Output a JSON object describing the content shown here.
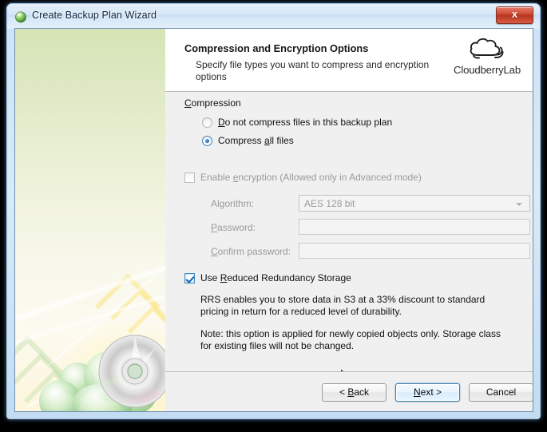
{
  "window": {
    "title": "Create Backup Plan Wizard",
    "title_icon": "green-sphere-icon",
    "close_label": "x"
  },
  "header": {
    "title": "Compression and Encryption Options",
    "subtitle": "Specify file types you want to compress and encryption options",
    "logo_text": "CloudberryLab",
    "logo_icon": "cloud-icon"
  },
  "compression": {
    "group_label": "Compression",
    "group_label_pre": "C",
    "group_label_post": "ompression",
    "options": [
      {
        "pre": "D",
        "rest_a": "o not compress files in this backup plan",
        "full": "Do not compress files in this backup plan",
        "selected": false
      },
      {
        "pre": "Compress ",
        "accel": "a",
        "post": "ll files",
        "full": "Compress all files",
        "selected": true
      }
    ]
  },
  "encryption": {
    "enable_pre": "Enable ",
    "enable_accel": "e",
    "enable_post": "ncryption (Allowed only in Advanced mode)",
    "enable_full": "Enable encryption (Allowed only in Advanced mode)",
    "enabled": false,
    "algorithm_label": "Algorithm:",
    "algorithm_label_pre": "Al",
    "algorithm_label_accel": "g",
    "algorithm_label_post": "orithm:",
    "algorithm_value": "AES 128 bit",
    "algorithm_options": [
      "AES 128 bit"
    ],
    "password_label": "Password:",
    "password_label_accel": "P",
    "password_label_post": "assword:",
    "password_value": "",
    "confirm_label": "Confirm password:",
    "confirm_label_accel": "C",
    "confirm_label_post": "onfirm password:",
    "confirm_value": ""
  },
  "rrs": {
    "checked": true,
    "label_pre": "Use ",
    "label_accel": "R",
    "label_post": "educed Redundancy Storage",
    "label_full": "Use Reduced Redundancy Storage",
    "paragraph_1": "RRS enables you to store data in S3 at a 33% discount to standard pricing in return for a reduced level of durability.",
    "paragraph_2": "Note: this option is applied for newly copied objects only. Storage class for existing files will not be changed."
  },
  "footer": {
    "back_pre": "< ",
    "back_accel": "B",
    "back_post": "ack",
    "back_label": "< Back",
    "next_pre": "",
    "next_accel": "N",
    "next_post": "ext >",
    "next_label": "Next >",
    "cancel_label": "Cancel"
  },
  "colors": {
    "accent_blue": "#3c7fb1",
    "close_red": "#cf4a36",
    "pane_bg": "#f0f0f0",
    "disabled_text": "#9a9a9a"
  }
}
